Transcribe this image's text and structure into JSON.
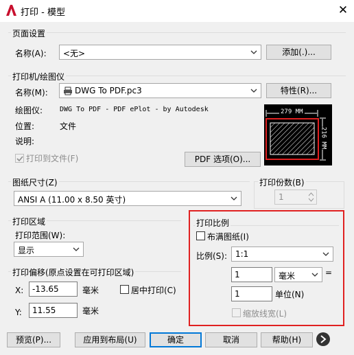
{
  "window": {
    "title": "打印 - 模型",
    "close": "✕"
  },
  "page_setup": {
    "legend": "页面设置",
    "name_label": "名称(A):",
    "name_value": "<无>",
    "add_button": "添加(.)..."
  },
  "printer": {
    "legend": "打印机/绘图仪",
    "name_label": "名称(M):",
    "name_value": "DWG To PDF.pc3",
    "properties_button": "特性(R)...",
    "plotter_label": "绘图仪:",
    "plotter_value": "DWG To PDF - PDF ePlot - by Autodesk",
    "location_label": "位置:",
    "location_value": "文件",
    "description_label": "说明:",
    "print_to_file": "打印到文件(F)",
    "pdf_options_button": "PDF 选项(O)...",
    "preview_width": "279 MM",
    "preview_height": "216 MM"
  },
  "paper_size": {
    "legend": "图纸尺寸(Z)",
    "value": "ANSI A (11.00 x 8.50 英寸)"
  },
  "copies": {
    "legend": "打印份数(B)",
    "value": "1"
  },
  "plot_area": {
    "legend": "打印区域",
    "range_label": "打印范围(W):",
    "range_value": "显示"
  },
  "plot_offset": {
    "legend": "打印偏移(原点设置在可打印区域)",
    "x_label": "X:",
    "x_value": "-13.65",
    "x_unit": "毫米",
    "y_label": "Y:",
    "y_value": "11.55",
    "y_unit": "毫米",
    "center_label": "居中打印(C)"
  },
  "plot_scale": {
    "legend": "打印比例",
    "fit_label": "布满图纸(I)",
    "scale_label": "比例(S):",
    "scale_value": "1:1",
    "value1": "1",
    "unit_value": "毫米",
    "equals": "=",
    "value2": "1",
    "unit_label": "单位(N)",
    "lineweights_label": "缩放线宽(L)"
  },
  "footer": {
    "preview": "预览(P)...",
    "apply_layout": "应用到布局(U)",
    "ok": "确定",
    "cancel": "取消",
    "help": "帮助(H)"
  },
  "colors": {
    "highlight": "#e02020",
    "accent": "#0078d7",
    "brand": "#c8102e"
  }
}
